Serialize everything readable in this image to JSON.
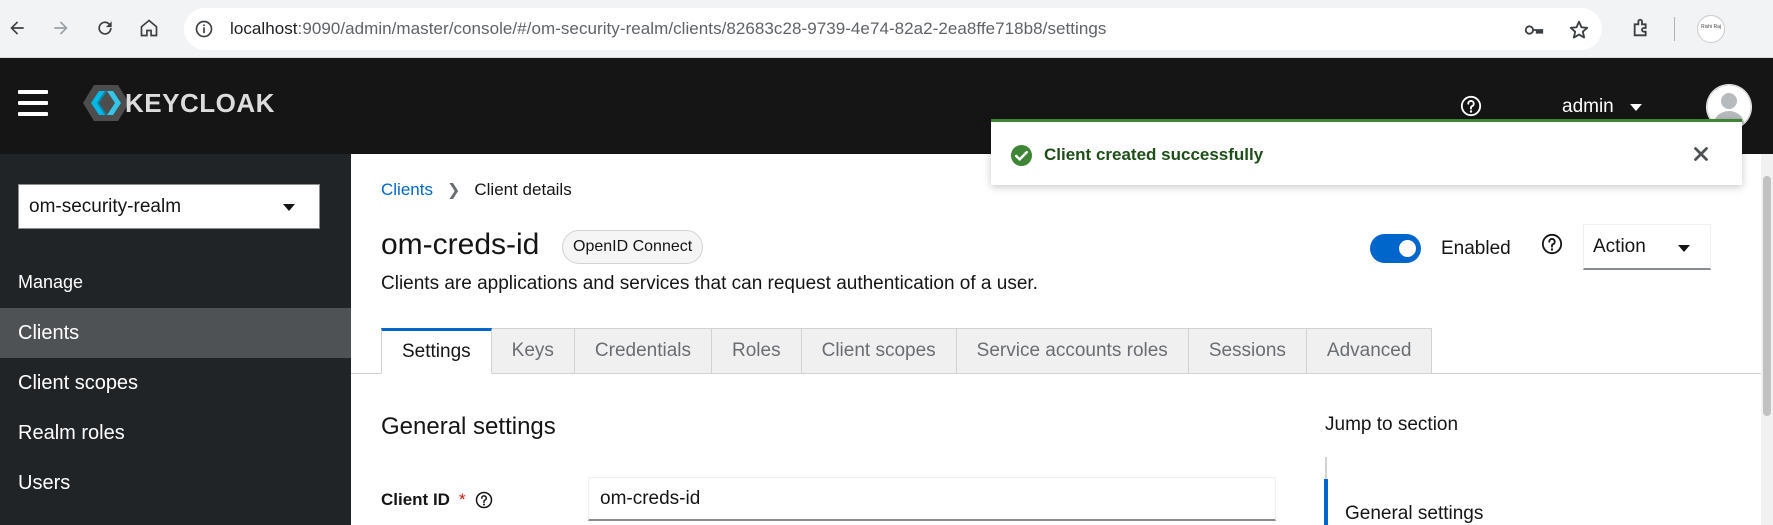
{
  "browser": {
    "url_host": "localhost",
    "url_path": ":9090/admin/master/console/#/om-security-realm/clients/82683c28-9739-4e74-82a2-2ea8ffe718b8/settings",
    "profile_text": "Rishi Raj",
    "icons": [
      "back-icon",
      "forward-icon",
      "reload-icon",
      "home-icon",
      "site-info-icon",
      "key-icon",
      "star-icon",
      "extensions-icon"
    ]
  },
  "header": {
    "logo_text": "KEYCLOAK",
    "user_label": "admin"
  },
  "sidebar": {
    "realm": "om-security-realm",
    "section_label": "Manage",
    "items": [
      {
        "label": "Clients",
        "active": true
      },
      {
        "label": "Client scopes",
        "active": false
      },
      {
        "label": "Realm roles",
        "active": false
      },
      {
        "label": "Users",
        "active": false
      }
    ]
  },
  "main": {
    "breadcrumb": {
      "link": "Clients",
      "current": "Client details"
    },
    "title": "om-creds-id",
    "protocol_badge": "OpenID Connect",
    "description": "Clients are applications and services that can request authentication of a user.",
    "enabled_label": "Enabled",
    "enabled": true,
    "action_label": "Action",
    "tabs": [
      {
        "label": "Settings",
        "active": true
      },
      {
        "label": "Keys",
        "active": false
      },
      {
        "label": "Credentials",
        "active": false
      },
      {
        "label": "Roles",
        "active": false
      },
      {
        "label": "Client scopes",
        "active": false
      },
      {
        "label": "Service accounts roles",
        "active": false
      },
      {
        "label": "Sessions",
        "active": false
      },
      {
        "label": "Advanced",
        "active": false
      }
    ],
    "section_title": "General settings",
    "client_id_label": "Client ID",
    "required_marker": "*",
    "client_id_value": "om-creds-id",
    "jump_to_title": "Jump to section",
    "jump_items": [
      "General settings"
    ]
  },
  "toast": {
    "message": "Client created successfully",
    "variant_color": "#3e8635"
  },
  "colors": {
    "accent": "#0066cc",
    "header_bg": "#151515",
    "sidebar_bg": "#212427",
    "sidebar_active": "#4f5255",
    "success": "#3e8635"
  }
}
